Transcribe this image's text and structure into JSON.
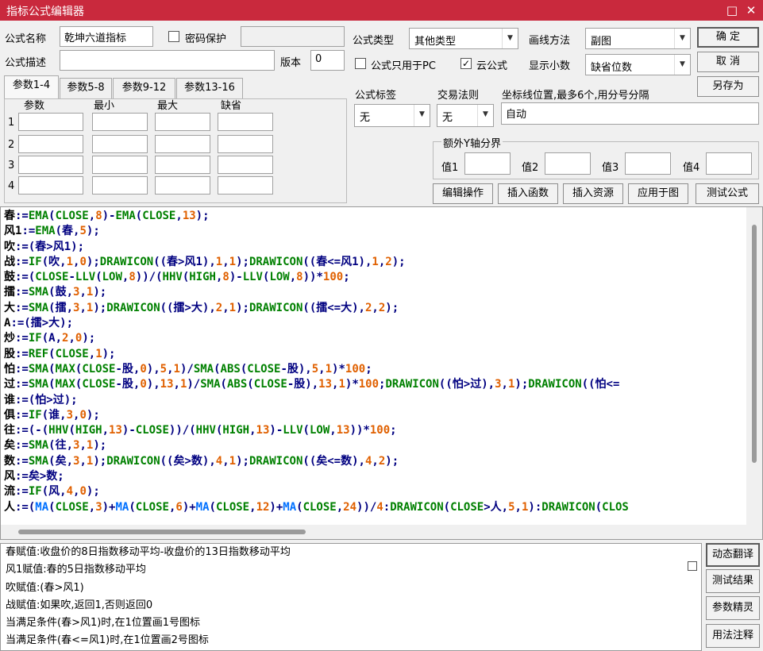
{
  "window": {
    "title": "指标公式编辑器",
    "minimize_glyph": "□",
    "close_glyph": "✕"
  },
  "form": {
    "name_label": "公式名称",
    "name_value": "乾坤六道指标",
    "password_label": "密码保护",
    "password_value": "",
    "desc_label": "公式描述",
    "desc_value": "",
    "version_label": "版本",
    "version_value": "0",
    "type_label": "公式类型",
    "type_value": "其他类型",
    "draw_label": "画线方法",
    "draw_value": "副图",
    "pc_only_label": "公式只用于PC",
    "pc_only_checked": "",
    "cloud_label": "云公式",
    "cloud_checked": "✓",
    "decimal_label": "显示小数",
    "decimal_value": "缺省位数",
    "tag_label": "公式标签",
    "tag_value": "无",
    "trade_label": "交易法则",
    "trade_value": "无",
    "coord_label": "坐标线位置,最多6个,用分号分隔",
    "coord_value": "自动",
    "yaxis_group": "额外Y轴分界",
    "y1": "值1",
    "y2": "值2",
    "y3": "值3",
    "y4": "值4"
  },
  "buttons": {
    "ok": "确  定",
    "cancel": "取  消",
    "save_as": "另存为",
    "edit_ops": "编辑操作",
    "insert_func": "插入函数",
    "insert_res": "插入资源",
    "apply": "应用于图",
    "test": "测试公式"
  },
  "params": {
    "tabs": [
      "参数1-4",
      "参数5-8",
      "参数9-12",
      "参数13-16"
    ],
    "headers": [
      "参数",
      "最小",
      "最大",
      "缺省"
    ],
    "rows": [
      "1",
      "2",
      "3",
      "4"
    ]
  },
  "code_lines": [
    [
      [
        "a",
        "春"
      ],
      [
        "b",
        ":="
      ],
      [
        "g",
        "EMA"
      ],
      [
        "b",
        "("
      ],
      [
        "g",
        "CLOSE"
      ],
      [
        "b",
        ","
      ],
      [
        "o",
        "8"
      ],
      [
        "b",
        ")-"
      ],
      [
        "g",
        "EMA"
      ],
      [
        "b",
        "("
      ],
      [
        "g",
        "CLOSE"
      ],
      [
        "b",
        ","
      ],
      [
        "o",
        "13"
      ],
      [
        "b",
        ");"
      ]
    ],
    [
      [
        "a",
        "风1"
      ],
      [
        "b",
        ":="
      ],
      [
        "g",
        "EMA"
      ],
      [
        "b",
        "(春,"
      ],
      [
        "o",
        "5"
      ],
      [
        "b",
        ");"
      ]
    ],
    [
      [
        "a",
        "吹"
      ],
      [
        "b",
        ":=(春>风1);"
      ]
    ],
    [
      [
        "a",
        "战"
      ],
      [
        "b",
        ":="
      ],
      [
        "g",
        "IF"
      ],
      [
        "b",
        "(吹,"
      ],
      [
        "o",
        "1"
      ],
      [
        "b",
        ","
      ],
      [
        "o",
        "0"
      ],
      [
        "b",
        ");"
      ],
      [
        "g",
        "DRAWICON"
      ],
      [
        "b",
        "((春>风1),"
      ],
      [
        "o",
        "1"
      ],
      [
        "b",
        ","
      ],
      [
        "o",
        "1"
      ],
      [
        "b",
        ");"
      ],
      [
        "g",
        "DRAWICON"
      ],
      [
        "b",
        "((春<=风1),"
      ],
      [
        "o",
        "1"
      ],
      [
        "b",
        ","
      ],
      [
        "o",
        "2"
      ],
      [
        "b",
        ");"
      ]
    ],
    [
      [
        "a",
        "鼓"
      ],
      [
        "b",
        ":=("
      ],
      [
        "g",
        "CLOSE"
      ],
      [
        "b",
        "-"
      ],
      [
        "g",
        "LLV"
      ],
      [
        "b",
        "("
      ],
      [
        "g",
        "LOW"
      ],
      [
        "b",
        ","
      ],
      [
        "o",
        "8"
      ],
      [
        "b",
        "))/("
      ],
      [
        "g",
        "HHV"
      ],
      [
        "b",
        "("
      ],
      [
        "g",
        "HIGH"
      ],
      [
        "b",
        ","
      ],
      [
        "o",
        "8"
      ],
      [
        "b",
        ")-"
      ],
      [
        "g",
        "LLV"
      ],
      [
        "b",
        "("
      ],
      [
        "g",
        "LOW"
      ],
      [
        "b",
        ","
      ],
      [
        "o",
        "8"
      ],
      [
        "b",
        "))*"
      ],
      [
        "o",
        "100"
      ],
      [
        "b",
        ";"
      ]
    ],
    [
      [
        "a",
        "擂"
      ],
      [
        "b",
        ":="
      ],
      [
        "g",
        "SMA"
      ],
      [
        "b",
        "(鼓,"
      ],
      [
        "o",
        "3"
      ],
      [
        "b",
        ","
      ],
      [
        "o",
        "1"
      ],
      [
        "b",
        ");"
      ]
    ],
    [
      [
        "a",
        "大"
      ],
      [
        "b",
        ":="
      ],
      [
        "g",
        "SMA"
      ],
      [
        "b",
        "(擂,"
      ],
      [
        "o",
        "3"
      ],
      [
        "b",
        ","
      ],
      [
        "o",
        "1"
      ],
      [
        "b",
        ");"
      ],
      [
        "g",
        "DRAWICON"
      ],
      [
        "b",
        "((擂>大),"
      ],
      [
        "o",
        "2"
      ],
      [
        "b",
        ","
      ],
      [
        "o",
        "1"
      ],
      [
        "b",
        ");"
      ],
      [
        "g",
        "DRAWICON"
      ],
      [
        "b",
        "((擂<=大),"
      ],
      [
        "o",
        "2"
      ],
      [
        "b",
        ","
      ],
      [
        "o",
        "2"
      ],
      [
        "b",
        ");"
      ]
    ],
    [
      [
        "a",
        "A"
      ],
      [
        "b",
        ":=(擂>大);"
      ]
    ],
    [
      [
        "a",
        "炒"
      ],
      [
        "b",
        ":="
      ],
      [
        "g",
        "IF"
      ],
      [
        "b",
        "(A,"
      ],
      [
        "o",
        "2"
      ],
      [
        "b",
        ","
      ],
      [
        "o",
        "0"
      ],
      [
        "b",
        ");"
      ]
    ],
    [
      [
        "a",
        "股"
      ],
      [
        "b",
        ":="
      ],
      [
        "g",
        "REF"
      ],
      [
        "b",
        "("
      ],
      [
        "g",
        "CLOSE"
      ],
      [
        "b",
        ","
      ],
      [
        "o",
        "1"
      ],
      [
        "b",
        ");"
      ]
    ],
    [
      [
        "a",
        "怕"
      ],
      [
        "b",
        ":="
      ],
      [
        "g",
        "SMA"
      ],
      [
        "b",
        "("
      ],
      [
        "g",
        "MAX"
      ],
      [
        "b",
        "("
      ],
      [
        "g",
        "CLOSE"
      ],
      [
        "b",
        "-股,"
      ],
      [
        "o",
        "0"
      ],
      [
        "b",
        "),"
      ],
      [
        "o",
        "5"
      ],
      [
        "b",
        ","
      ],
      [
        "o",
        "1"
      ],
      [
        "b",
        ")/"
      ],
      [
        "g",
        "SMA"
      ],
      [
        "b",
        "("
      ],
      [
        "g",
        "ABS"
      ],
      [
        "b",
        "("
      ],
      [
        "g",
        "CLOSE"
      ],
      [
        "b",
        "-股),"
      ],
      [
        "o",
        "5"
      ],
      [
        "b",
        ","
      ],
      [
        "o",
        "1"
      ],
      [
        "b",
        ")*"
      ],
      [
        "o",
        "100"
      ],
      [
        "b",
        ";"
      ]
    ],
    [
      [
        "a",
        "过"
      ],
      [
        "b",
        ":="
      ],
      [
        "g",
        "SMA"
      ],
      [
        "b",
        "("
      ],
      [
        "g",
        "MAX"
      ],
      [
        "b",
        "("
      ],
      [
        "g",
        "CLOSE"
      ],
      [
        "b",
        "-股,"
      ],
      [
        "o",
        "0"
      ],
      [
        "b",
        "),"
      ],
      [
        "o",
        "13"
      ],
      [
        "b",
        ","
      ],
      [
        "o",
        "1"
      ],
      [
        "b",
        ")/"
      ],
      [
        "g",
        "SMA"
      ],
      [
        "b",
        "("
      ],
      [
        "g",
        "ABS"
      ],
      [
        "b",
        "("
      ],
      [
        "g",
        "CLOSE"
      ],
      [
        "b",
        "-股),"
      ],
      [
        "o",
        "13"
      ],
      [
        "b",
        ","
      ],
      [
        "o",
        "1"
      ],
      [
        "b",
        ")*"
      ],
      [
        "o",
        "100"
      ],
      [
        "b",
        ";"
      ],
      [
        "g",
        "DRAWICON"
      ],
      [
        "b",
        "((怕>过),"
      ],
      [
        "o",
        "3"
      ],
      [
        "b",
        ","
      ],
      [
        "o",
        "1"
      ],
      [
        "b",
        ");"
      ],
      [
        "g",
        "DRAWICON"
      ],
      [
        "b",
        "((怕<="
      ]
    ],
    [
      [
        "a",
        "谁"
      ],
      [
        "b",
        ":=(怕>过);"
      ]
    ],
    [
      [
        "a",
        "俱"
      ],
      [
        "b",
        ":="
      ],
      [
        "g",
        "IF"
      ],
      [
        "b",
        "(谁,"
      ],
      [
        "o",
        "3"
      ],
      [
        "b",
        ","
      ],
      [
        "o",
        "0"
      ],
      [
        "b",
        ");"
      ]
    ],
    [
      [
        "a",
        "往"
      ],
      [
        "b",
        ":=(-("
      ],
      [
        "g",
        "HHV"
      ],
      [
        "b",
        "("
      ],
      [
        "g",
        "HIGH"
      ],
      [
        "b",
        ","
      ],
      [
        "o",
        "13"
      ],
      [
        "b",
        ")-"
      ],
      [
        "g",
        "CLOSE"
      ],
      [
        "b",
        "))/("
      ],
      [
        "g",
        "HHV"
      ],
      [
        "b",
        "("
      ],
      [
        "g",
        "HIGH"
      ],
      [
        "b",
        ","
      ],
      [
        "o",
        "13"
      ],
      [
        "b",
        ")-"
      ],
      [
        "g",
        "LLV"
      ],
      [
        "b",
        "("
      ],
      [
        "g",
        "LOW"
      ],
      [
        "b",
        ","
      ],
      [
        "o",
        "13"
      ],
      [
        "b",
        "))*"
      ],
      [
        "o",
        "100"
      ],
      [
        "b",
        ";"
      ]
    ],
    [
      [
        "a",
        "矣"
      ],
      [
        "b",
        ":="
      ],
      [
        "g",
        "SMA"
      ],
      [
        "b",
        "(往,"
      ],
      [
        "o",
        "3"
      ],
      [
        "b",
        ","
      ],
      [
        "o",
        "1"
      ],
      [
        "b",
        ");"
      ]
    ],
    [
      [
        "a",
        "数"
      ],
      [
        "b",
        ":="
      ],
      [
        "g",
        "SMA"
      ],
      [
        "b",
        "(矣,"
      ],
      [
        "o",
        "3"
      ],
      [
        "b",
        ","
      ],
      [
        "o",
        "1"
      ],
      [
        "b",
        ");"
      ],
      [
        "g",
        "DRAWICON"
      ],
      [
        "b",
        "((矣>数),"
      ],
      [
        "o",
        "4"
      ],
      [
        "b",
        ","
      ],
      [
        "o",
        "1"
      ],
      [
        "b",
        ");"
      ],
      [
        "g",
        "DRAWICON"
      ],
      [
        "b",
        "((矣<=数),"
      ],
      [
        "o",
        "4"
      ],
      [
        "b",
        ","
      ],
      [
        "o",
        "2"
      ],
      [
        "b",
        ");"
      ]
    ],
    [
      [
        "a",
        "风"
      ],
      [
        "b",
        ":=矣>数;"
      ]
    ],
    [
      [
        "a",
        "流"
      ],
      [
        "b",
        ":="
      ],
      [
        "g",
        "IF"
      ],
      [
        "b",
        "(风,"
      ],
      [
        "o",
        "4"
      ],
      [
        "b",
        ","
      ],
      [
        "o",
        "0"
      ],
      [
        "b",
        ");"
      ]
    ],
    [
      [
        "a",
        "人"
      ],
      [
        "b",
        ":=("
      ],
      [
        "c",
        "MA"
      ],
      [
        "b",
        "("
      ],
      [
        "g",
        "CLOSE"
      ],
      [
        "b",
        ","
      ],
      [
        "o",
        "3"
      ],
      [
        "b",
        ")+"
      ],
      [
        "c",
        "MA"
      ],
      [
        "b",
        "("
      ],
      [
        "g",
        "CLOSE"
      ],
      [
        "b",
        ","
      ],
      [
        "o",
        "6"
      ],
      [
        "b",
        ")+"
      ],
      [
        "c",
        "MA"
      ],
      [
        "b",
        "("
      ],
      [
        "g",
        "CLOSE"
      ],
      [
        "b",
        ","
      ],
      [
        "o",
        "12"
      ],
      [
        "b",
        ")+"
      ],
      [
        "c",
        "MA"
      ],
      [
        "b",
        "("
      ],
      [
        "g",
        "CLOSE"
      ],
      [
        "b",
        ","
      ],
      [
        "o",
        "24"
      ],
      [
        "b",
        "))/"
      ],
      [
        "o",
        "4"
      ],
      [
        "b",
        ":"
      ],
      [
        "g",
        "DRAWICON"
      ],
      [
        "b",
        "("
      ],
      [
        "g",
        "CLOSE"
      ],
      [
        "b",
        ">人,"
      ],
      [
        "o",
        "5"
      ],
      [
        "b",
        ","
      ],
      [
        "o",
        "1"
      ],
      [
        "b",
        "):"
      ],
      [
        "g",
        "DRAWICON"
      ],
      [
        "b",
        "("
      ],
      [
        "g",
        "CLOS"
      ]
    ]
  ],
  "code_colors": {
    "a": "#000000",
    "b": "#000080",
    "g": "#008000",
    "o": "#e06000",
    "c": "#0070ff"
  },
  "notes": [
    "春赋值:收盘价的8日指数移动平均-收盘价的13日指数移动平均",
    "风1赋值:春的5日指数移动平均",
    "吹赋值:(春>风1)",
    "战赋值:如果吹,返回1,否则返回0",
    "当满足条件(春>风1)时,在1位置画1号图标",
    "当满足条件(春<=风1)时,在1位置画2号图标"
  ],
  "side_buttons": {
    "dynamic": "动态翻译",
    "results": "测试结果",
    "params": "参数精灵",
    "usage": "用法注释"
  }
}
